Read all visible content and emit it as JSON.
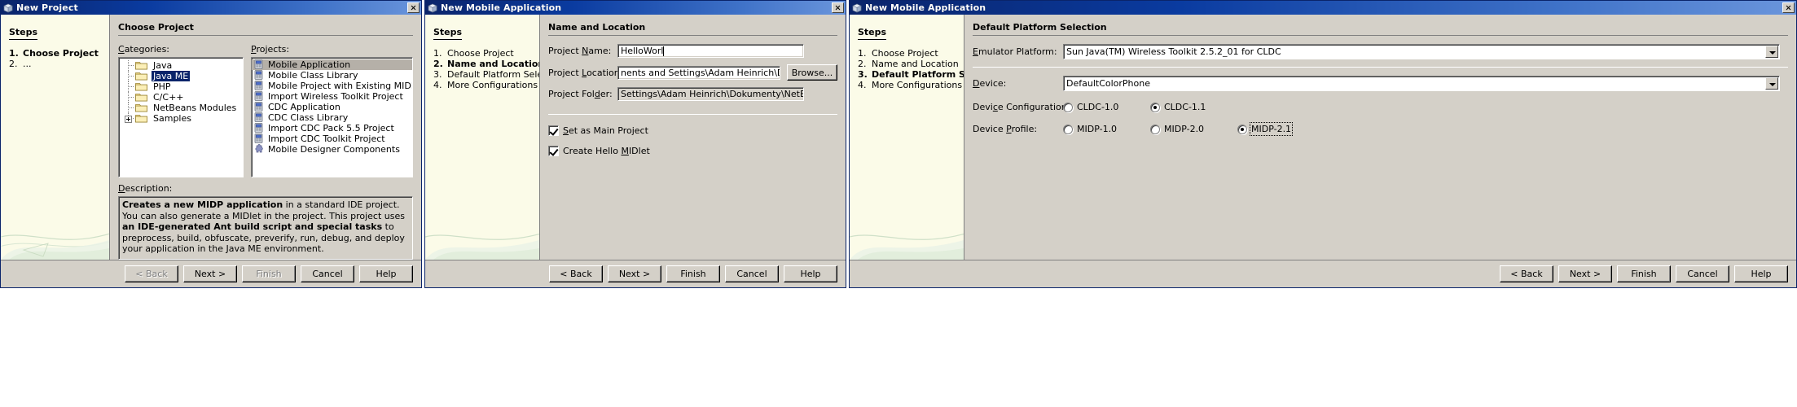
{
  "dialogs": [
    {
      "title": "New Project",
      "title_icon": "cube-icon",
      "steps_head": "Steps",
      "steps": [
        {
          "num": "1.",
          "label": "Choose Project",
          "active": true
        },
        {
          "num": "2.",
          "label": "...",
          "active": false
        }
      ],
      "pane_head": "Choose Project",
      "categories_label": "Categories:",
      "projects_label": "Projects:",
      "categories": [
        {
          "label": "Java",
          "selected": false,
          "expandable": false
        },
        {
          "label": "Java ME",
          "selected": true,
          "expandable": false
        },
        {
          "label": "PHP",
          "selected": false,
          "expandable": false
        },
        {
          "label": "C/C++",
          "selected": false,
          "expandable": false
        },
        {
          "label": "NetBeans Modules",
          "selected": false,
          "expandable": false
        },
        {
          "label": "Samples",
          "selected": false,
          "expandable": true
        }
      ],
      "projects": [
        {
          "label": "Mobile Application",
          "selected": true,
          "icon": "mobile-project-icon"
        },
        {
          "label": "Mobile Class Library",
          "selected": false,
          "icon": "mobile-project-icon"
        },
        {
          "label": "Mobile Project with Existing MIDP Sources",
          "selected": false,
          "icon": "mobile-project-icon"
        },
        {
          "label": "Import Wireless Toolkit Project",
          "selected": false,
          "icon": "mobile-project-icon"
        },
        {
          "label": "CDC Application",
          "selected": false,
          "icon": "mobile-project-icon"
        },
        {
          "label": "CDC Class Library",
          "selected": false,
          "icon": "mobile-project-icon"
        },
        {
          "label": "Import CDC Pack 5.5 Project",
          "selected": false,
          "icon": "mobile-project-icon"
        },
        {
          "label": "Import CDC Toolkit Project",
          "selected": false,
          "icon": "mobile-project-icon"
        },
        {
          "label": "Mobile Designer Components",
          "selected": false,
          "icon": "puzzle-piece-icon"
        }
      ],
      "description_label": "Description:",
      "description_parts": [
        {
          "text": "Creates a new MIDP application",
          "bold": true
        },
        {
          "text": " in a standard IDE project. You can also generate a MIDlet in the project. This project uses ",
          "bold": false
        },
        {
          "text": "an IDE-generated Ant build script and special tasks",
          "bold": true
        },
        {
          "text": " to preprocess, build, obfuscate, preverify, run, debug, and deploy your application in the Java ME environment.",
          "bold": false
        }
      ],
      "buttons": [
        {
          "label": "< Back",
          "disabled": true,
          "name": "back-button"
        },
        {
          "label": "Next >",
          "disabled": false,
          "name": "next-button"
        },
        {
          "label": "Finish",
          "disabled": true,
          "name": "finish-button"
        },
        {
          "label": "Cancel",
          "disabled": false,
          "name": "cancel-button"
        },
        {
          "label": "Help",
          "disabled": false,
          "name": "help-button"
        }
      ]
    },
    {
      "title": "New Mobile Application",
      "title_icon": "cube-icon",
      "steps_head": "Steps",
      "steps": [
        {
          "num": "1.",
          "label": "Choose Project",
          "active": false
        },
        {
          "num": "2.",
          "label": "Name and Location",
          "active": true
        },
        {
          "num": "3.",
          "label": "Default Platform Selection",
          "active": false
        },
        {
          "num": "4.",
          "label": "More Configurations Selection",
          "active": false
        }
      ],
      "pane_head": "Name and Location",
      "fields": [
        {
          "label": "Project Name:",
          "value": "HelloWorl",
          "readonly": false,
          "caret": true,
          "name": "project-name-field"
        },
        {
          "label": "Project Location:",
          "value": "nents and Settings\\Adam Heinrich\\Dokumenty\\NetBeansProjects",
          "readonly": false,
          "caret": false,
          "name": "project-location-field"
        },
        {
          "label": "Project Folder:",
          "value": "Settings\\Adam Heinrich\\Dokumenty\\NetBeansProjects\\HelloWorl",
          "readonly": true,
          "caret": false,
          "name": "project-folder-field"
        }
      ],
      "browse_label": "Browse...",
      "checkboxes": [
        {
          "label": "Set as Main Project",
          "checked": true,
          "name": "set-as-main-project-checkbox"
        },
        {
          "label": "Create Hello MIDlet",
          "checked": true,
          "name": "create-hello-midlet-checkbox"
        }
      ],
      "buttons": [
        {
          "label": "< Back",
          "disabled": false,
          "name": "back-button"
        },
        {
          "label": "Next >",
          "disabled": false,
          "name": "next-button"
        },
        {
          "label": "Finish",
          "disabled": false,
          "name": "finish-button"
        },
        {
          "label": "Cancel",
          "disabled": false,
          "name": "cancel-button"
        },
        {
          "label": "Help",
          "disabled": false,
          "name": "help-button"
        }
      ]
    },
    {
      "title": "New Mobile Application",
      "title_icon": "cube-icon",
      "steps_head": "Steps",
      "steps": [
        {
          "num": "1.",
          "label": "Choose Project",
          "active": false
        },
        {
          "num": "2.",
          "label": "Name and Location",
          "active": false
        },
        {
          "num": "3.",
          "label": "Default Platform Selection",
          "active": true
        },
        {
          "num": "4.",
          "label": "More Configurations Selection",
          "active": false
        }
      ],
      "pane_head": "Default Platform Selection",
      "emulator_label": "Emulator Platform:",
      "emulator_value": "Sun Java(TM) Wireless Toolkit 2.5.2_01 for CLDC",
      "device_label": "Device:",
      "device_value": "DefaultColorPhone",
      "config_label": "Device Configuration:",
      "config_options": [
        {
          "label": "CLDC-1.0",
          "checked": false,
          "name": "radio-cldc-1-0"
        },
        {
          "label": "CLDC-1.1",
          "checked": true,
          "name": "radio-cldc-1-1"
        }
      ],
      "profile_label": "Device Profile:",
      "profile_options": [
        {
          "label": "MIDP-1.0",
          "checked": false,
          "focused": false,
          "name": "radio-midp-1-0"
        },
        {
          "label": "MIDP-2.0",
          "checked": false,
          "focused": false,
          "name": "radio-midp-2-0"
        },
        {
          "label": "MIDP-2.1",
          "checked": true,
          "focused": true,
          "name": "radio-midp-2-1"
        }
      ],
      "buttons": [
        {
          "label": "< Back",
          "disabled": false,
          "name": "back-button"
        },
        {
          "label": "Next >",
          "disabled": false,
          "name": "next-button"
        },
        {
          "label": "Finish",
          "disabled": false,
          "name": "finish-button"
        },
        {
          "label": "Cancel",
          "disabled": false,
          "name": "cancel-button"
        },
        {
          "label": "Help",
          "disabled": false,
          "name": "help-button"
        }
      ]
    }
  ]
}
